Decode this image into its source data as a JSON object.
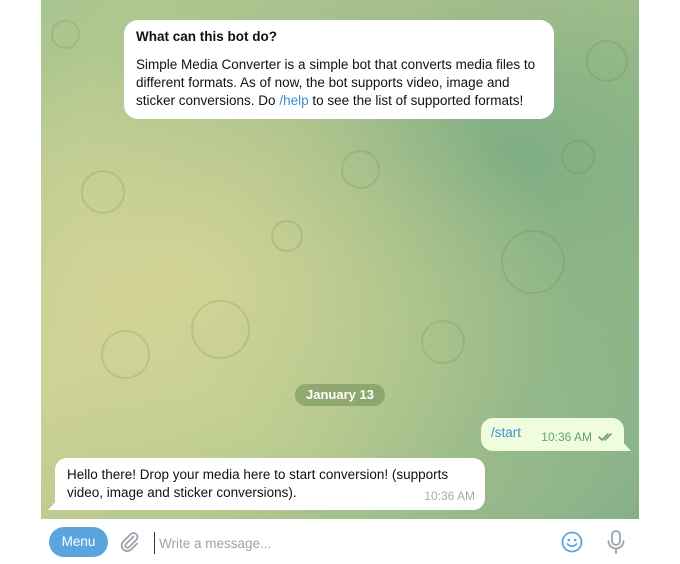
{
  "intro": {
    "title": "What can this bot do?",
    "text_before_link": "Simple Media Converter is a simple bot that converts media files to different formats. As of now, the bot supports video, image and sticker conversions. Do ",
    "link": "/help",
    "text_after_link": " to see the list of supported formats!"
  },
  "date_separator": "January 13",
  "outgoing": {
    "text": "/start",
    "time": "10:36 AM",
    "status_icon": "double-check-icon"
  },
  "incoming": {
    "text": "Hello there! Drop your media here to start conversion! (supports video, image and sticker conversions).",
    "time": "10:36 AM"
  },
  "composer": {
    "menu_label": "Menu",
    "placeholder": "Write a message...",
    "attach_icon": "paperclip-icon",
    "emoji_icon": "smile-icon",
    "mic_icon": "microphone-icon"
  },
  "colors": {
    "accent": "#5aa5dd",
    "link": "#3a8fd3",
    "outgoing_bubble": "#effdde",
    "check": "#6ca067"
  }
}
